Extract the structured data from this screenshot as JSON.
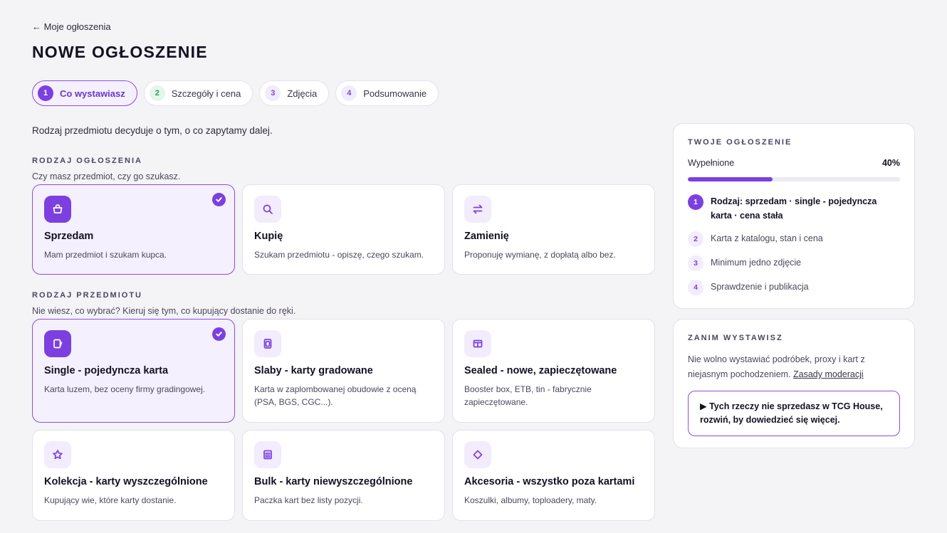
{
  "header": {
    "back_label": "← Moje ogłoszenia",
    "title": "NOWE OGŁOSZENIE"
  },
  "steps": [
    {
      "num": "1",
      "label": "Co wystawiasz",
      "state": "active"
    },
    {
      "num": "2",
      "label": "Szczegóły i cena",
      "state": "green"
    },
    {
      "num": "3",
      "label": "Zdjęcia",
      "state": "pending"
    },
    {
      "num": "4",
      "label": "Podsumowanie",
      "state": "pending"
    }
  ],
  "intro": "Rodzaj przedmiotu decyduje o tym, o co zapytamy dalej.",
  "listing_type": {
    "label": "RODZAJ OGŁOSZENIA",
    "hint": "Czy masz przedmiot, czy go szukasz.",
    "options": [
      {
        "title": "Sprzedam",
        "desc": "Mam przedmiot i szukam kupca.",
        "icon": "basket-icon",
        "selected": true
      },
      {
        "title": "Kupię",
        "desc": "Szukam przedmiotu - opiszę, czego szukam.",
        "icon": "search-icon",
        "selected": false
      },
      {
        "title": "Zamienię",
        "desc": "Proponuję wymianę, z dopłatą albo bez.",
        "icon": "swap-icon",
        "selected": false
      }
    ]
  },
  "item_type": {
    "label": "RODZAJ PRZEDMIOTU",
    "hint": "Nie wiesz, co wybrać? Kieruj się tym, co kupujący dostanie do ręki.",
    "options": [
      {
        "title": "Single - pojedyncza karta",
        "desc": "Karta luzem, bez oceny firmy gradingowej.",
        "icon": "card-icon",
        "selected": true
      },
      {
        "title": "Slaby - karty gradowane",
        "desc": "Karta w zaplombowanej obudowie z oceną (PSA, BGS, CGC...).",
        "icon": "slab-icon",
        "selected": false
      },
      {
        "title": "Sealed - nowe, zapieczętowane",
        "desc": "Booster box, ETB, tin - fabrycznie zapieczętowane.",
        "icon": "box-icon",
        "selected": false
      },
      {
        "title": "Kolekcja - karty wyszczególnione",
        "desc": "Kupujący wie, które karty dostanie.",
        "icon": "star-icon",
        "selected": false
      },
      {
        "title": "Bulk - karty niewyszczególnione",
        "desc": "Paczka kart bez listy pozycji.",
        "icon": "stack-icon",
        "selected": false
      },
      {
        "title": "Akcesoria - wszystko poza kartami",
        "desc": "Koszulki, albumy, toploadery, maty.",
        "icon": "diamond-icon",
        "selected": false
      }
    ]
  },
  "summary": {
    "title": "TWOJE OGŁOSZENIE",
    "progress_label": "Wypełnione",
    "progress_value": "40%",
    "progress_fraction": 0.4,
    "items": [
      {
        "num": "1",
        "text": "Rodzaj: sprzedam · single - pojedyncza karta · cena stała",
        "done": true
      },
      {
        "num": "2",
        "text": "Karta z katalogu, stan i cena",
        "done": false
      },
      {
        "num": "3",
        "text": "Minimum jedno zdjęcie",
        "done": false
      },
      {
        "num": "4",
        "text": "Sprawdzenie i publikacja",
        "done": false
      }
    ]
  },
  "before": {
    "title": "ZANIM WYSTAWISZ",
    "body": "Nie wolno wystawiać podróbek, proxy i kart z niejasnym pochodzeniem.",
    "link": "Zasady moderacji",
    "details": "▶ Tych rzeczy nie sprzedasz w TCG House, rozwiń, by dowiedzieć się więcej."
  },
  "colors": {
    "accent": "#7c3fe0",
    "background": "#f4f3f6"
  }
}
